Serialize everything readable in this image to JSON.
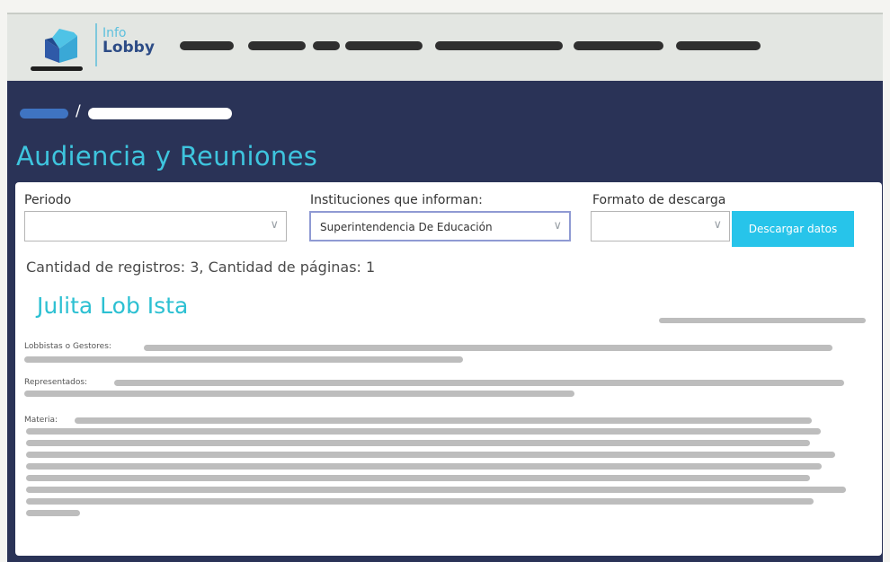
{
  "header": {
    "logo": {
      "icon": "book-logo-icon",
      "line1": "Info",
      "line2": "Lobby"
    },
    "nav_items": [
      "",
      "",
      "",
      "",
      "",
      "",
      ""
    ]
  },
  "breadcrumb": {
    "separator": "/"
  },
  "page_title": "Audiencia y Reuniones",
  "filters": {
    "periodo": {
      "label": "Periodo",
      "value": ""
    },
    "instituciones": {
      "label": "Instituciones que informan:",
      "value": "Superintendencia De Educación"
    },
    "formato": {
      "label": "Formato de descarga",
      "value": ""
    },
    "download_label": "Descargar datos"
  },
  "summary": "Cantidad de registros: 3, Cantidad de páginas: 1",
  "record": {
    "name": "Julita Lob Ista",
    "fields": {
      "lobbistas_label": "Lobbistas o Gestores:",
      "representados_label": "Representados:",
      "materia_label": "Materia:"
    }
  },
  "colors": {
    "accent": "#27c4ea",
    "title": "#3ec5de",
    "band": "#2a3357",
    "brand_dark": "#2d4c86"
  }
}
